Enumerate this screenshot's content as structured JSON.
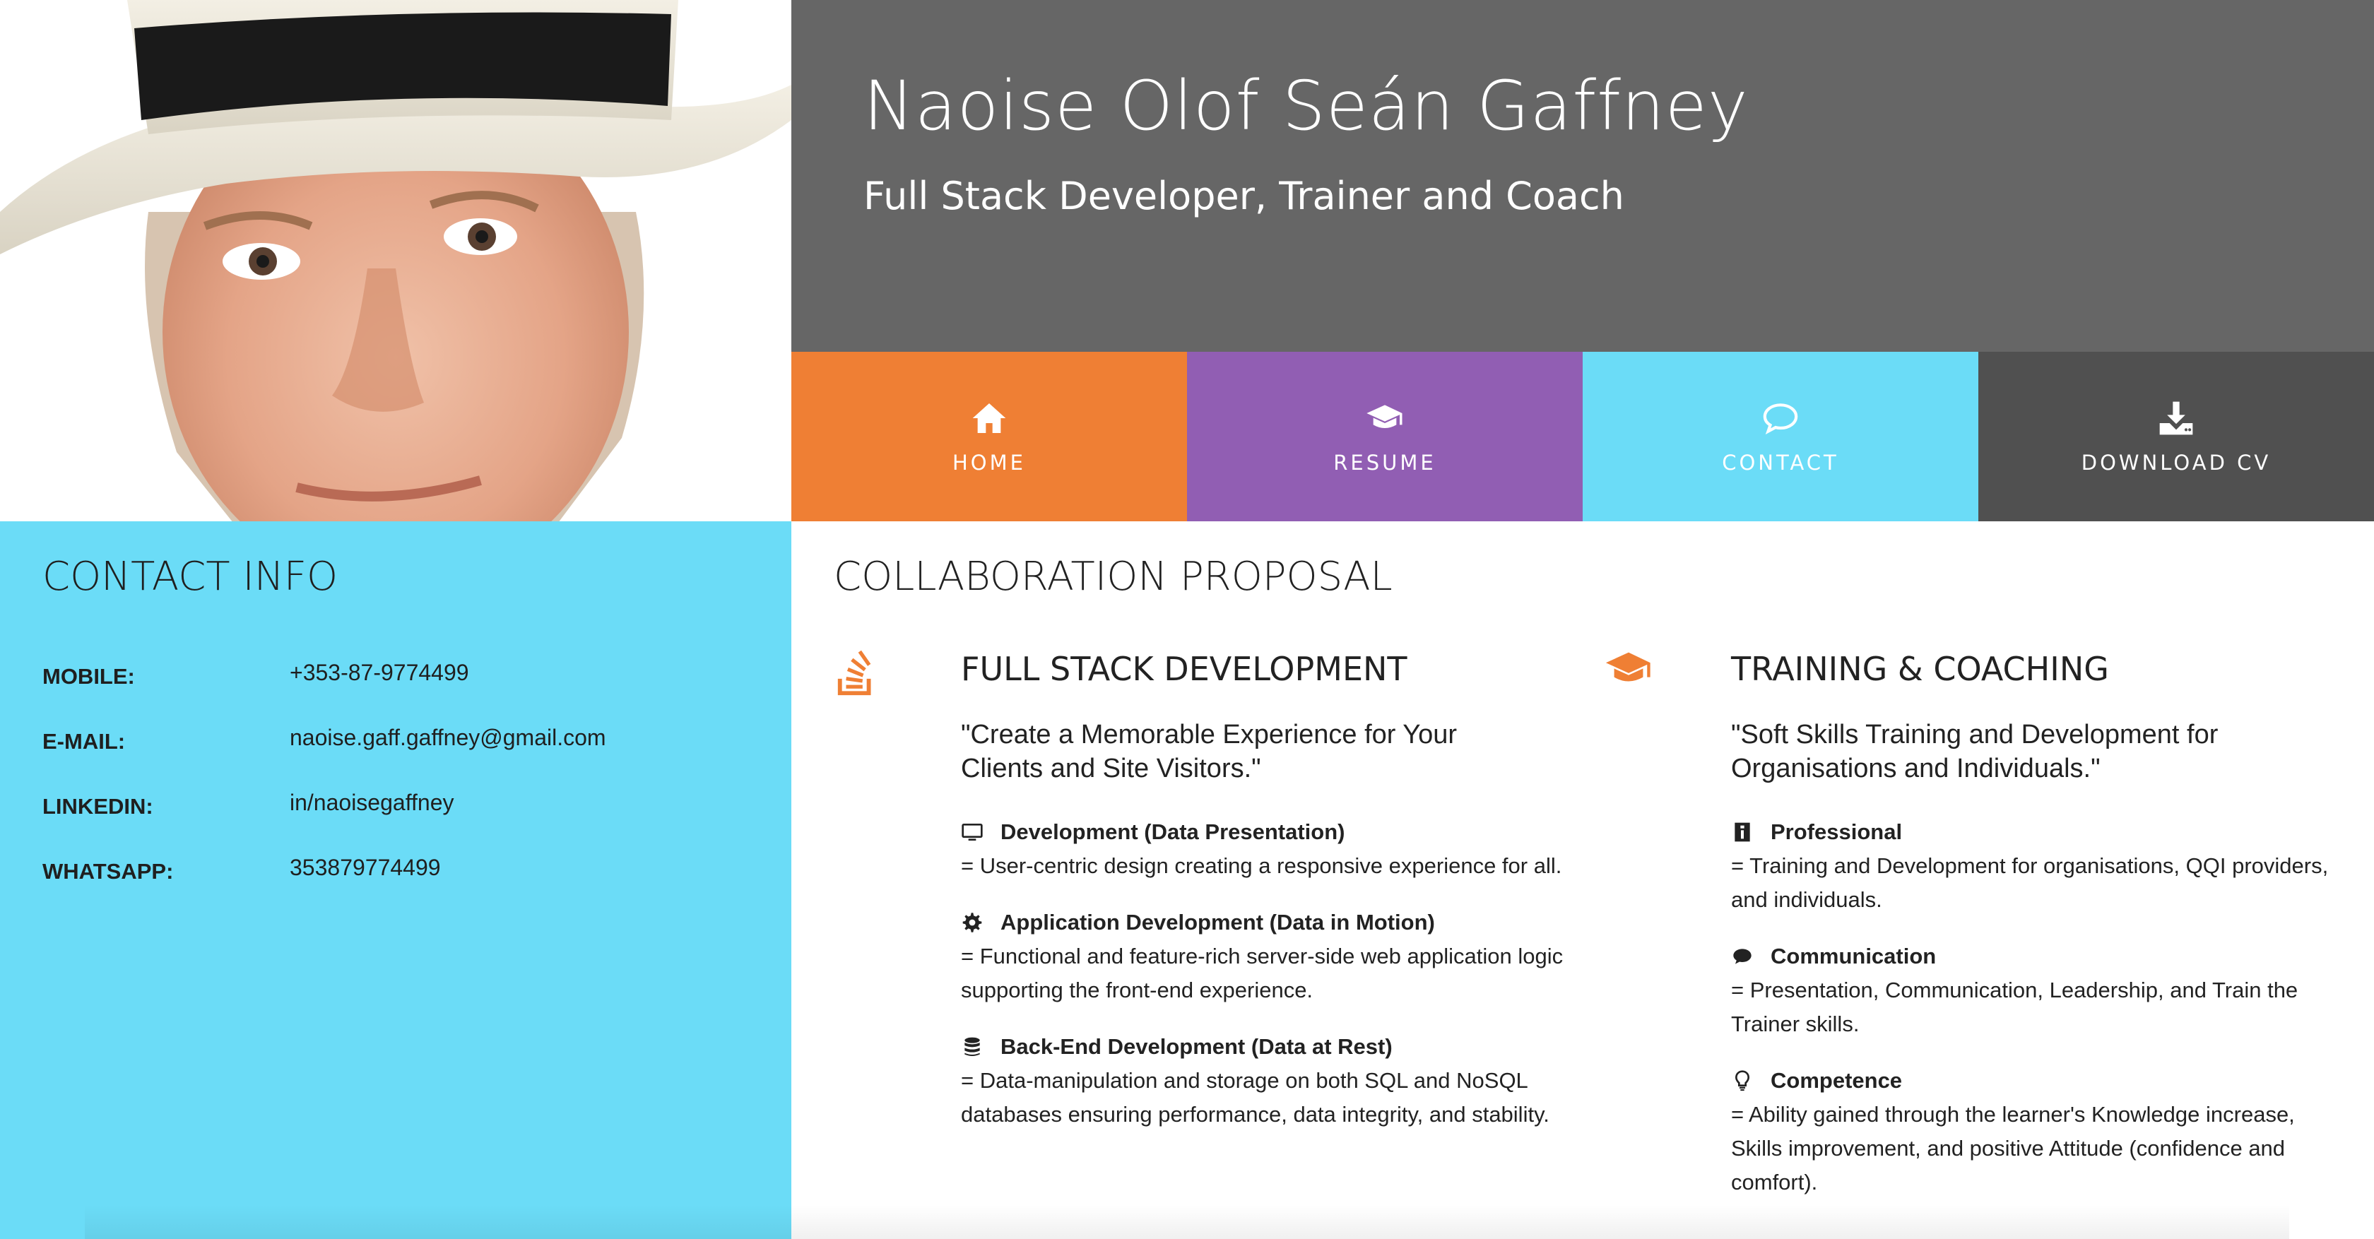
{
  "header": {
    "name": "Naoise Olof Seán Gaffney",
    "subtitle": "Full Stack Developer, Trainer and Coach"
  },
  "nav": [
    {
      "label": "HOME",
      "icon": "home-icon",
      "color": "#ef7f34"
    },
    {
      "label": "RESUME",
      "icon": "graduation-cap-icon",
      "color": "#915eb3"
    },
    {
      "label": "CONTACT",
      "icon": "speech-bubble-icon",
      "color": "#6bdcf7"
    },
    {
      "label": "DOWNLOAD CV",
      "icon": "download-icon",
      "color": "#505050"
    }
  ],
  "contact": {
    "title": "CONTACT INFO",
    "rows": [
      {
        "label": "MOBILE:",
        "value": "+353-87-9774499"
      },
      {
        "label": "E-MAIL:",
        "value": "naoise.gaff.gaffney@gmail.com"
      },
      {
        "label": "LINKEDIN:",
        "value": "in/naoisegaffney"
      },
      {
        "label": "WHATSAPP:",
        "value": "353879774499"
      }
    ]
  },
  "collab": {
    "title": "COLLABORATION PROPOSAL",
    "columns": [
      {
        "icon": "stack-overflow-icon",
        "heading": "FULL STACK DEVELOPMENT",
        "quote": "\"Create a Memorable Experience for Your Clients and Site Visitors.\"",
        "items": [
          {
            "icon": "monitor-icon",
            "title": "Development (Data Presentation)",
            "desc": "= User-centric design creating a responsive experience for all."
          },
          {
            "icon": "gear-icon",
            "title": "Application Development (Data in Motion)",
            "desc": "= Functional and feature-rich server-side web application logic supporting the front-end experience."
          },
          {
            "icon": "database-icon",
            "title": "Back-End Development (Data at Rest)",
            "desc": "= Data-manipulation and storage on both SQL and NoSQL databases ensuring performance, data integrity, and stability."
          }
        ]
      },
      {
        "icon": "graduation-cap-icon",
        "heading": "TRAINING & COACHING",
        "quote": "\"Soft Skills Training and Development for Organisations and Individuals.\"",
        "items": [
          {
            "icon": "id-badge-icon",
            "title": "Professional",
            "desc": "= Training and Development for organisations, QQI providers, and individuals."
          },
          {
            "icon": "comment-icon",
            "title": "Communication",
            "desc": "= Presentation, Communication, Leadership, and Train the Trainer skills."
          },
          {
            "icon": "lightbulb-icon",
            "title": "Competence",
            "desc": "= Ability gained through the learner's Knowledge increase, Skills improvement, and positive Attitude (confidence and comfort)."
          }
        ]
      }
    ]
  },
  "colors": {
    "header_bg": "#666666",
    "contact_bg": "#6bdcf7",
    "accent_orange": "#ef7f34"
  }
}
